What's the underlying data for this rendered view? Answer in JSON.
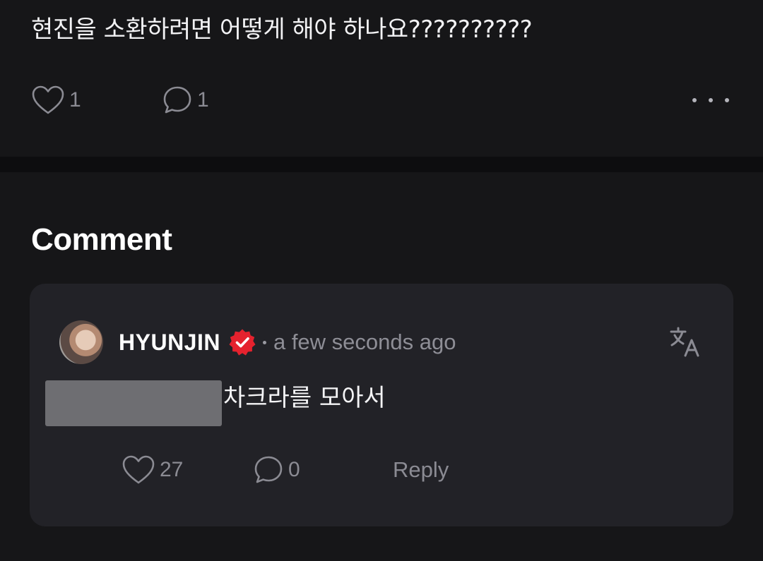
{
  "post": {
    "text": "현진을 소환하려면 어떻게 해야 하나요??????????",
    "likes": "1",
    "comments": "1",
    "icons": {
      "like": "heart-icon",
      "comment": "speech-bubble-icon",
      "more": "more-dots-icon"
    }
  },
  "comments_section": {
    "title": "Comment",
    "items": [
      {
        "author": "HYUNJIN",
        "verified": true,
        "timestamp": "a few seconds ago",
        "text": "차크라를 모아서",
        "likes": "27",
        "replies": "0",
        "reply_label": "Reply",
        "icons": {
          "avatar": "avatar-photo",
          "badge": "verified-badge-icon",
          "translate": "translate-icon",
          "like": "heart-icon",
          "comment": "speech-bubble-icon"
        }
      }
    ]
  },
  "colors": {
    "background": "#161618",
    "card": "#222227",
    "divider": "#0d0d0f",
    "text_primary": "#ffffff",
    "text_secondary": "#8b8b93",
    "badge": "#e5222e"
  }
}
